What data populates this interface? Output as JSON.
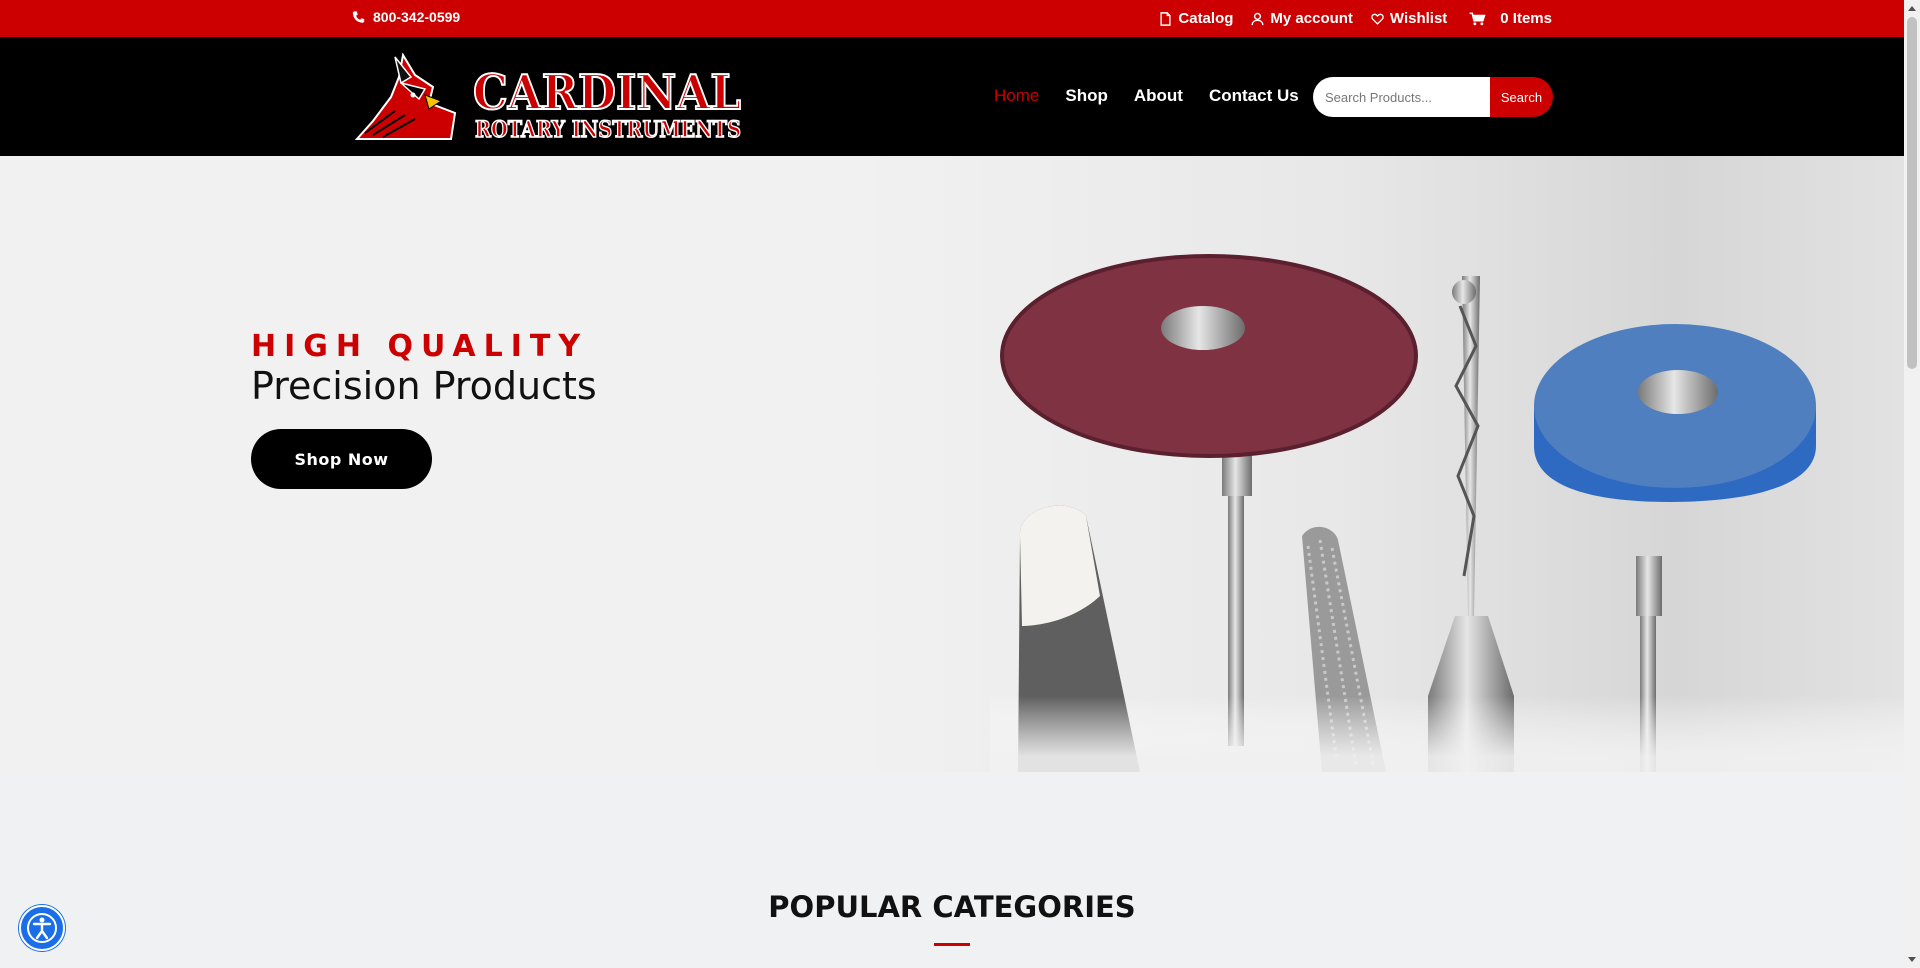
{
  "topbar": {
    "phone": "800-342-0599",
    "links": [
      {
        "label": "Catalog",
        "icon": "document-icon"
      },
      {
        "label": "My account",
        "icon": "user-icon"
      },
      {
        "label": "Wishlist",
        "icon": "heart-icon"
      },
      {
        "label": "0 Items",
        "icon": "cart-icon"
      }
    ]
  },
  "brand": {
    "logo_text_1": "CARDINAL",
    "logo_text_2": "ROTARY INSTRUMENTS"
  },
  "nav": {
    "items": [
      "Home",
      "Shop",
      "About",
      "Contact Us"
    ],
    "active": "Home"
  },
  "search": {
    "placeholder": "Search Products...",
    "button_label": "Search"
  },
  "hero": {
    "kicker": "HIGH QUALITY",
    "headline": "Precision Products",
    "cta_label": "Shop Now"
  },
  "section": {
    "title": "POPULAR CATEGORIES"
  },
  "colors": {
    "brand_red": "#cc0000",
    "header_black": "#000000",
    "a11y_blue": "#1a6ee8"
  }
}
